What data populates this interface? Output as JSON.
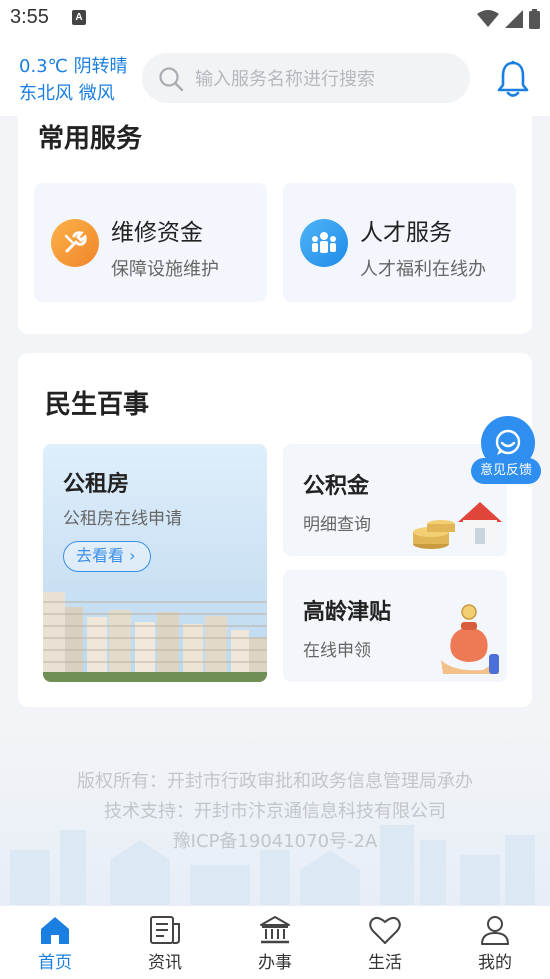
{
  "status": {
    "time": "3:55",
    "sim_label": "A"
  },
  "header": {
    "weather_line1": "0.3℃ 阴转晴",
    "weather_line2": "东北风 微风",
    "search_placeholder": "输入服务名称进行搜索"
  },
  "common_services": {
    "title": "常用服务",
    "items": [
      {
        "title": "维修资金",
        "subtitle": "保障设施维护",
        "icon": "wrench-icon",
        "color": "#f5962e"
      },
      {
        "title": "人才服务",
        "subtitle": "人才福利在线办",
        "icon": "people-icon",
        "color": "#2d9cf0"
      }
    ]
  },
  "livelihood": {
    "title": "民生百事",
    "housing": {
      "title": "公租房",
      "subtitle": "公租房在线申请",
      "button": "去看看"
    },
    "tiles": [
      {
        "title": "公积金",
        "subtitle": "明细查询",
        "icon": "house-coins-icon"
      },
      {
        "title": "高龄津贴",
        "subtitle": "在线申领",
        "icon": "money-bag-icon"
      }
    ]
  },
  "feedback": {
    "label": "意见反馈"
  },
  "footer": {
    "line1": "版权所有：开封市行政审批和政务信息管理局承办",
    "line2": "技术支持：开封市汴京通信息科技有限公司",
    "line3": "豫ICP备19041070号-2A"
  },
  "tabs": [
    {
      "label": "首页",
      "icon": "home-icon",
      "active": true
    },
    {
      "label": "资讯",
      "icon": "news-icon",
      "active": false
    },
    {
      "label": "办事",
      "icon": "government-building-icon",
      "active": false
    },
    {
      "label": "生活",
      "icon": "heart-icon",
      "active": false
    },
    {
      "label": "我的",
      "icon": "person-icon",
      "active": false
    }
  ],
  "colors": {
    "accent": "#1a7fe0",
    "card_bg": "#f3f7fd"
  }
}
